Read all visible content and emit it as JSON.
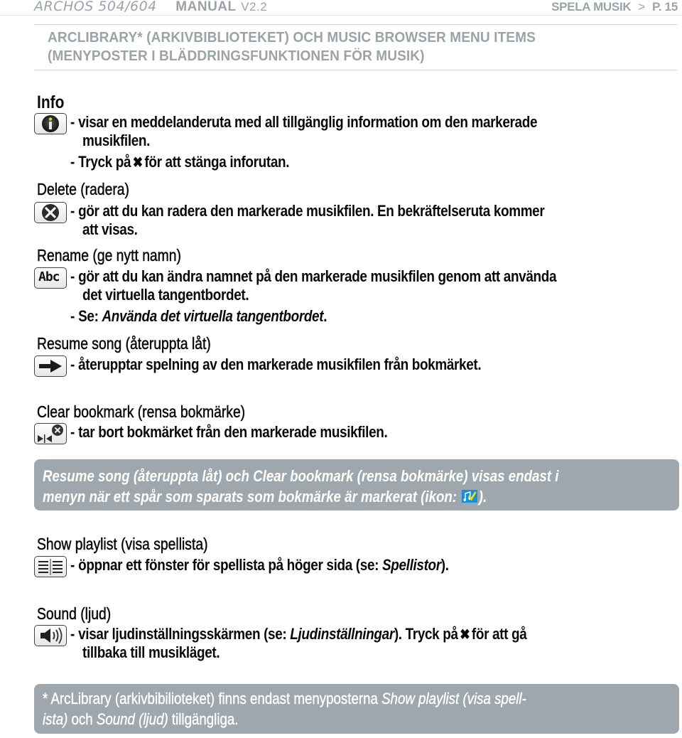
{
  "header": {
    "brand": "ARCHOS 504/604",
    "manual": "MANUAL",
    "version": "V2.2",
    "section": "SPELA MUSIK",
    "separator": ">",
    "page": "P. 15"
  },
  "title": {
    "line1": "ARCLIBRARY* (ARKIVBIBLIOTEKET) OCH  MUSIC BROWSER MENU ITEMS",
    "line2": "(MENYPOSTER I BLÄDDRINGSFUNKTIONEN FÖR MUSIK)"
  },
  "items": {
    "info": {
      "heading": "Info",
      "icon": "info-icon",
      "l1": "visar en meddelanderuta med all tillgänglig information om den markerade",
      "l2": "musikfilen.",
      "l3a": "Tryck på",
      "l3b": "för att stänga inforutan."
    },
    "delete": {
      "heading": "Delete (radera)",
      "icon": "delete-icon",
      "l1": "gör att du kan radera den markerade musikfilen. En bekräftelseruta kommer",
      "l2": "att visas."
    },
    "rename": {
      "heading": "Rename (ge nytt namn)",
      "icon": "rename-abc-icon",
      "icon_text": "Abc",
      "l1": "gör att du kan ändra namnet på den markerade musikfilen genom att använda",
      "l2": "det virtuella tangentbordet.",
      "l3a": "Se: ",
      "l3b": "Använda det virtuella tangentbordet",
      "l3c": "."
    },
    "resume": {
      "heading": "Resume song (återuppta låt)",
      "icon": "resume-arrow-icon",
      "l1": "återupptar spelning av den markerade musikfilen från bokmärket."
    },
    "clear": {
      "heading": "Clear bookmark (rensa bokmärke)",
      "icon": "clear-bookmark-icon",
      "l1": "tar bort bokmärket från den markerade musikfilen."
    },
    "playlist": {
      "heading": "Show playlist (visa spellista)",
      "icon": "playlist-icon",
      "l1a": "öppnar ett fönster för spellista på höger sida (se: ",
      "l1b": "Spellistor",
      "l1c": ")."
    },
    "sound": {
      "heading": "Sound (ljud)",
      "icon": "speaker-icon",
      "l1a": "visar ljudinställningsskärmen (se: ",
      "l1b": "Ljudinställningar",
      "l1c": "). Tryck på",
      "l1d": "för att gå",
      "l2": "tillbaka till musikläget."
    }
  },
  "notes": {
    "bookmark": {
      "l1": "Resume song (återuppta låt) och Clear bookmark (rensa bokmärke) visas endast i",
      "l2a": "menyn när ett spår som sparats som bokmärke är markerat (ikon: ",
      "l2b": ")."
    },
    "arclibrary": {
      "l1a": "* ArcLibrary (arkivbibilioteket) finns endast menyposterna ",
      "l1b": "Show playlist (visa spell-",
      "l2a": "ista)",
      "l2b": " och ",
      "l2c": "Sound (ljud)",
      "l2d": " tillgängliga."
    }
  },
  "glyphs": {
    "dash": "-",
    "close_x": "✖"
  },
  "colors": {
    "gray_text": "#9ba3a8",
    "note_bg": "#9ea7ad",
    "bookmark_blue": "#1a8fd6",
    "bookmark_check": "#e8e21a"
  }
}
